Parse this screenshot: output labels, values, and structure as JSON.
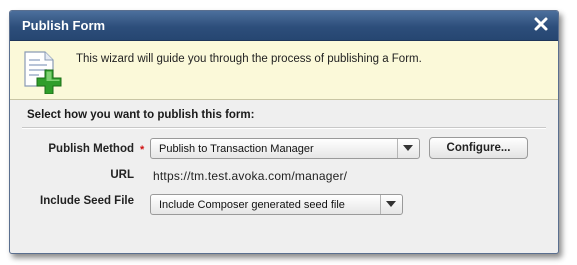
{
  "dialog": {
    "title": "Publish Form",
    "close_icon": "close-icon",
    "intro_text": "This wizard will guide you through the process of publishing a Form.",
    "intro_icon": "document-add-icon",
    "section_heading": "Select how you want to publish this form:"
  },
  "form": {
    "publish_method": {
      "label": "Publish Method",
      "required_marker": "*",
      "value": "Publish to Transaction Manager"
    },
    "configure_button": "Configure...",
    "url": {
      "label": "URL",
      "value": "https://tm.test.avoka.com/manager/"
    },
    "seed_file": {
      "label": "Include Seed File",
      "value": "Include Composer generated seed file"
    }
  },
  "colors": {
    "titlebar": "#2d4e7b",
    "banner": "#fbf9d9",
    "required": "#d01010",
    "icon_plus": "#2f9e2a"
  }
}
